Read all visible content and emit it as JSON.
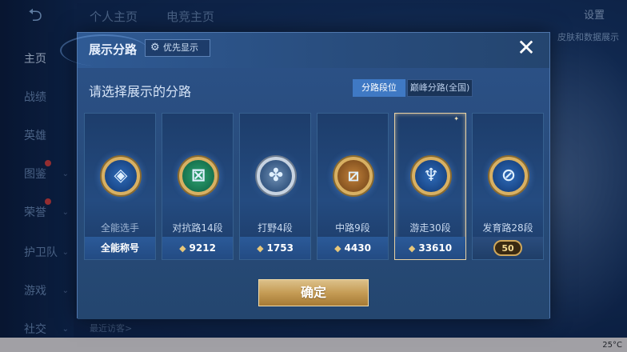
{
  "background": {
    "back_icon": "back-arrow-icon",
    "top_tabs": [
      "个人主页",
      "电竞主页"
    ],
    "settings_label": "设置",
    "top_right_button": "皮肤和数据展示",
    "sidebar": [
      {
        "label": "主页",
        "active": true,
        "chevron": false,
        "dot": false
      },
      {
        "label": "战绩",
        "active": false,
        "chevron": false,
        "dot": false
      },
      {
        "label": "英雄",
        "active": false,
        "chevron": false,
        "dot": false
      },
      {
        "label": "图鉴",
        "active": false,
        "chevron": true,
        "dot": true
      },
      {
        "label": "荣誉",
        "active": false,
        "chevron": true,
        "dot": true
      },
      {
        "label": "护卫队",
        "active": false,
        "chevron": true,
        "dot": false
      },
      {
        "label": "游戏",
        "active": false,
        "chevron": true,
        "dot": false
      },
      {
        "label": "社交",
        "active": false,
        "chevron": true,
        "dot": false
      }
    ],
    "recent_label": "最近访客>",
    "temperature": "25°C"
  },
  "modal": {
    "title": "展示分路",
    "priority_button": "优先显示",
    "priority_icon": "gear-icon",
    "close_icon": "close-icon",
    "prompt": "请选择展示的分路",
    "segments": {
      "active": "分路段位",
      "inactive": "巅峰分路(全国)"
    },
    "cards": [
      {
        "name": "全能选手",
        "foot": "全能称号",
        "foot_type": "title",
        "emblem": "allround-emblem-icon",
        "glyph": "◈",
        "tone": "blue",
        "selected": false
      },
      {
        "name": "对抗路14段",
        "foot": "9212",
        "foot_type": "points",
        "emblem": "clash-lane-emblem-icon",
        "glyph": "⊠",
        "tone": "green",
        "selected": false
      },
      {
        "name": "打野4段",
        "foot": "1753",
        "foot_type": "points",
        "emblem": "jungle-emblem-icon",
        "glyph": "✤",
        "tone": "silver",
        "selected": false
      },
      {
        "name": "中路9段",
        "foot": "4430",
        "foot_type": "points",
        "emblem": "mid-lane-emblem-icon",
        "glyph": "⧄",
        "tone": "bronze",
        "selected": false
      },
      {
        "name": "游走30段",
        "foot": "33610",
        "foot_type": "points",
        "emblem": "roam-emblem-icon",
        "glyph": "♆",
        "tone": "blue",
        "selected": true
      },
      {
        "name": "发育路28段",
        "foot": "50",
        "foot_type": "badge",
        "emblem": "farm-lane-emblem-icon",
        "glyph": "⊘",
        "tone": "blue",
        "selected": false
      }
    ],
    "points_icon": "points-diamond-icon",
    "confirm_label": "确定"
  }
}
